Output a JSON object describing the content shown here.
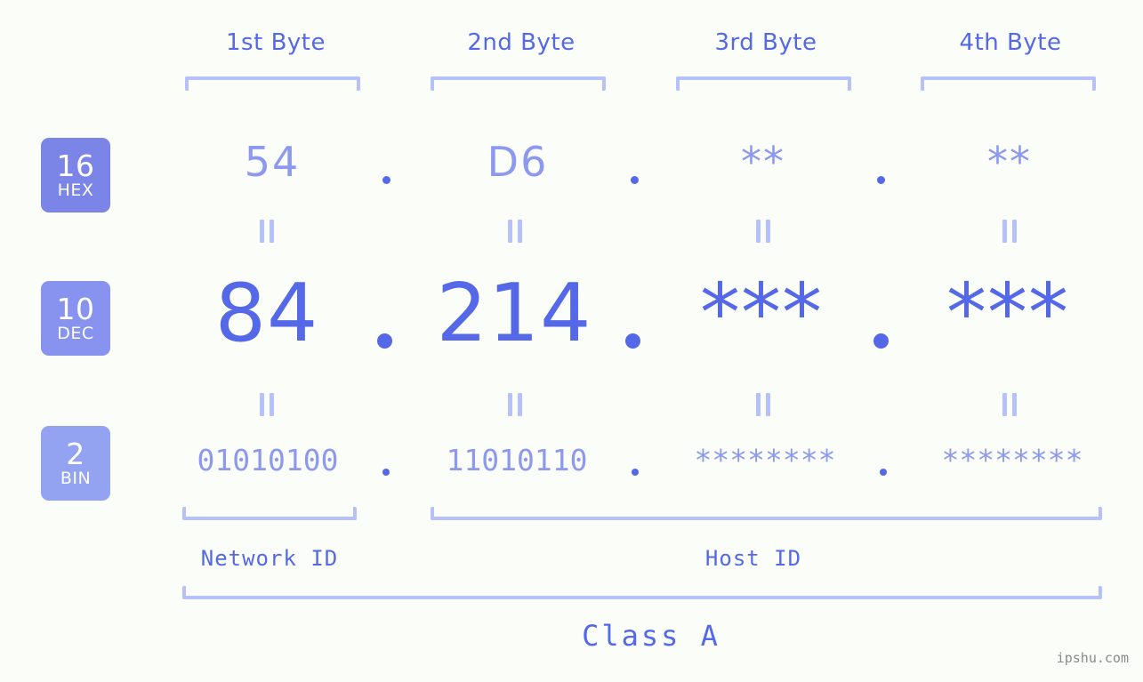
{
  "page": {
    "background_color": "#fbfdf9",
    "accent_color": "#5468e8",
    "accent_light_color": "#8c99ef",
    "bracket_color": "#b6c0fb"
  },
  "header": {
    "bytes": [
      {
        "label": "1st Byte"
      },
      {
        "label": "2nd Byte"
      },
      {
        "label": "3rd Byte"
      },
      {
        "label": "4th Byte"
      }
    ]
  },
  "bases": [
    {
      "number": "16",
      "name": "HEX",
      "color": "#7b85e8"
    },
    {
      "number": "10",
      "name": "DEC",
      "color": "#8793ee"
    },
    {
      "number": "2",
      "name": "BIN",
      "color": "#93a3f2"
    }
  ],
  "rows": {
    "hex": {
      "base_number": "16",
      "base_name": "HEX",
      "values": [
        "54",
        "D6",
        "**",
        "**"
      ],
      "separator": "."
    },
    "dec": {
      "base_number": "10",
      "base_name": "DEC",
      "values": [
        "84",
        "214",
        "***",
        "***"
      ],
      "separator": "."
    },
    "bin": {
      "base_number": "2",
      "base_name": "BIN",
      "values": [
        "01010100",
        "11010110",
        "********",
        "********"
      ],
      "separator": "."
    }
  },
  "equals_glyph": "=",
  "footer": {
    "network_id_label": "Network ID",
    "host_id_label": "Host ID",
    "class_label": "Class A"
  },
  "watermark": "ipshu.com"
}
